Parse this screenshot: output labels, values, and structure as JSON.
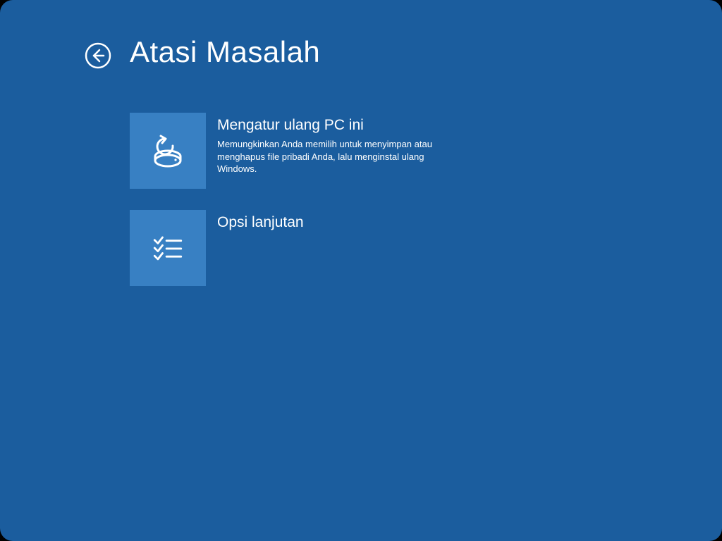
{
  "page": {
    "title": "Atasi Masalah"
  },
  "options": [
    {
      "icon": "reset-pc-icon",
      "title": "Mengatur ulang PC ini",
      "description": "Memungkinkan Anda memilih untuk menyimpan atau menghapus file pribadi Anda, lalu menginstal ulang Windows."
    },
    {
      "icon": "advanced-options-icon",
      "title": "Opsi lanjutan",
      "description": ""
    }
  ]
}
